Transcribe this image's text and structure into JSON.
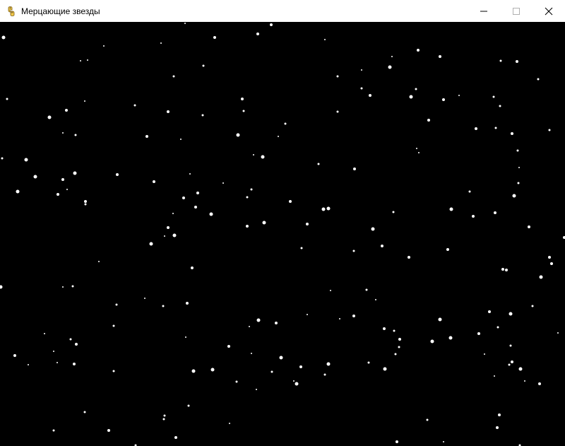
{
  "window": {
    "title": "Мерцающие звезды",
    "icon": "pygame-snake-icon",
    "controls": [
      "minimize-icon",
      "maximize-icon",
      "close-icon"
    ]
  },
  "scene": {
    "background": "#000000",
    "star_color": "#ffffff"
  }
}
